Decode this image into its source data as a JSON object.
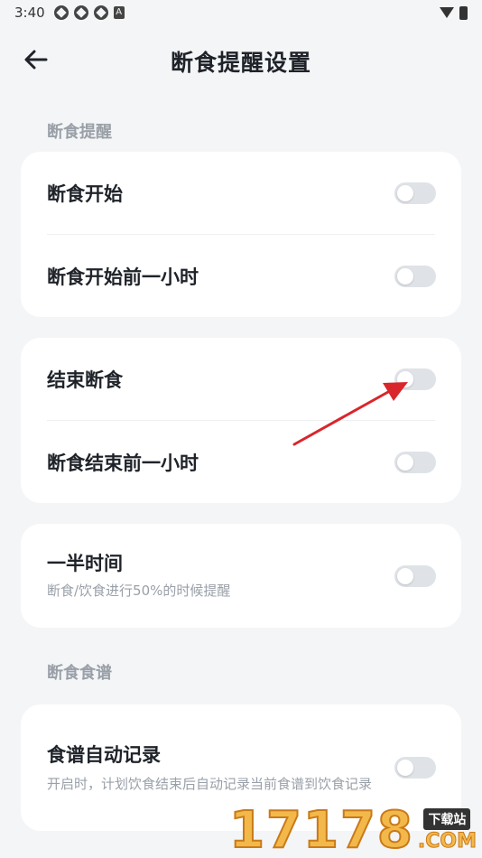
{
  "status_bar": {
    "time": "3:40",
    "left_icons": [
      "sync-icon",
      "sync-icon",
      "sync-icon",
      "a-notification-icon"
    ],
    "right_icons": [
      "wifi-icon",
      "battery-icon"
    ],
    "a_glyph": "A"
  },
  "header": {
    "title": "断食提醒设置",
    "back_icon": "back-arrow-icon"
  },
  "sections": {
    "reminders_label": "断食提醒",
    "recipes_label": "断食食谱"
  },
  "cards": {
    "start": {
      "rows": [
        {
          "title": "断食开始",
          "enabled": false
        },
        {
          "title": "断食开始前一小时",
          "enabled": false
        }
      ]
    },
    "end": {
      "rows": [
        {
          "title": "结束断食",
          "enabled": false
        },
        {
          "title": "断食结束前一小时",
          "enabled": false
        }
      ]
    },
    "half": {
      "title": "一半时间",
      "subtitle": "断食/饮食进行50%的时候提醒",
      "enabled": false
    },
    "recipe": {
      "title": "食谱自动记录",
      "subtitle": "开启时，计划饮食结束后自动记录当前食谱到饮食记录",
      "enabled": false
    }
  },
  "annotation": {
    "arrow_color": "#d9262b"
  },
  "watermark": {
    "number": "17178",
    "badge": "下载站",
    "suffix": ".COM"
  },
  "colors": {
    "background": "#f4f5f7",
    "card": "#ffffff",
    "toggle_off": "#dfe2e6",
    "muted_text": "#9aa0a8"
  }
}
